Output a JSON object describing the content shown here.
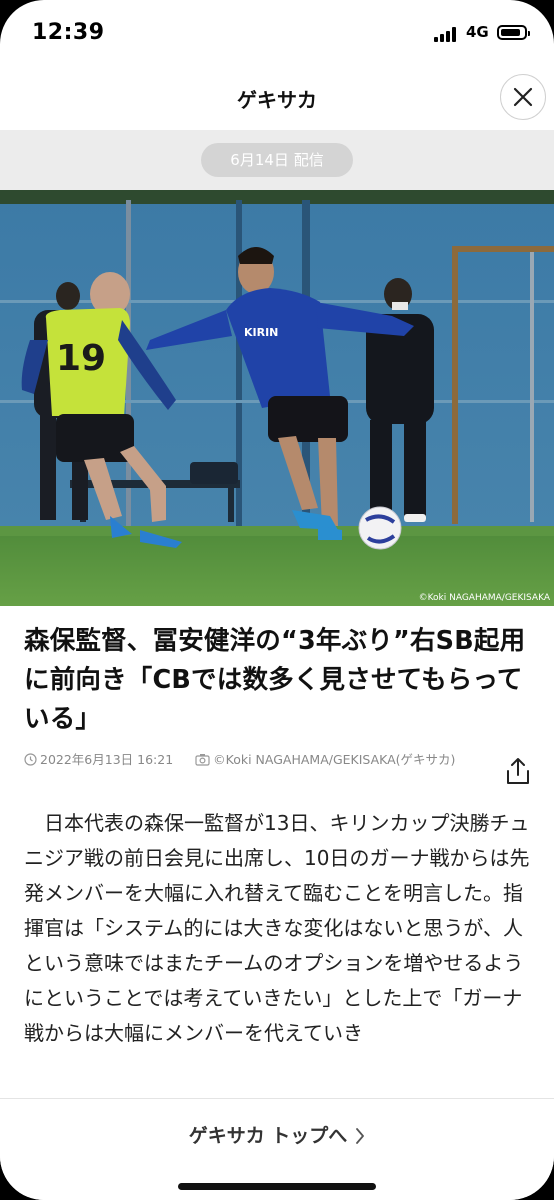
{
  "status": {
    "time": "12:39",
    "network": "4G",
    "battery_level": 0.85
  },
  "header": {
    "title": "ゲキサカ"
  },
  "date_pill": "6月14日 配信",
  "photo": {
    "credit": "©Koki NAGAHAMA/GEKISAKA",
    "jersey_number": "19",
    "shirt_sponsor": "KIRIN"
  },
  "article": {
    "headline": "森保監督、冨安健洋の“3年ぶり”右SB起用に前向き「CBでは数多く見させてもらっている」",
    "date": "2022年6月13日 16:21",
    "photo_credit": "©Koki NAGAHAMA/GEKISAKA(ゲキサカ)",
    "body": "日本代表の森保一監督が13日、キリンカップ決勝チュニジア戦の前日会見に出席し、10日のガーナ戦からは先発メンバーを大幅に入れ替えて臨むことを明言した。指揮官は「システム的には大きな変化はないと思うが、人という意味ではまたチームのオプションを増やせるようにということでは考えていきたい」とした上で「ガーナ戦からは大幅にメンバーを代えていき"
  },
  "footer": {
    "top_link": "ゲキサカ トップへ"
  },
  "icons": {
    "close": "close-icon",
    "share": "share-icon",
    "clock": "clock-icon",
    "camera": "camera-icon",
    "chevron": "chevron-right-icon"
  }
}
